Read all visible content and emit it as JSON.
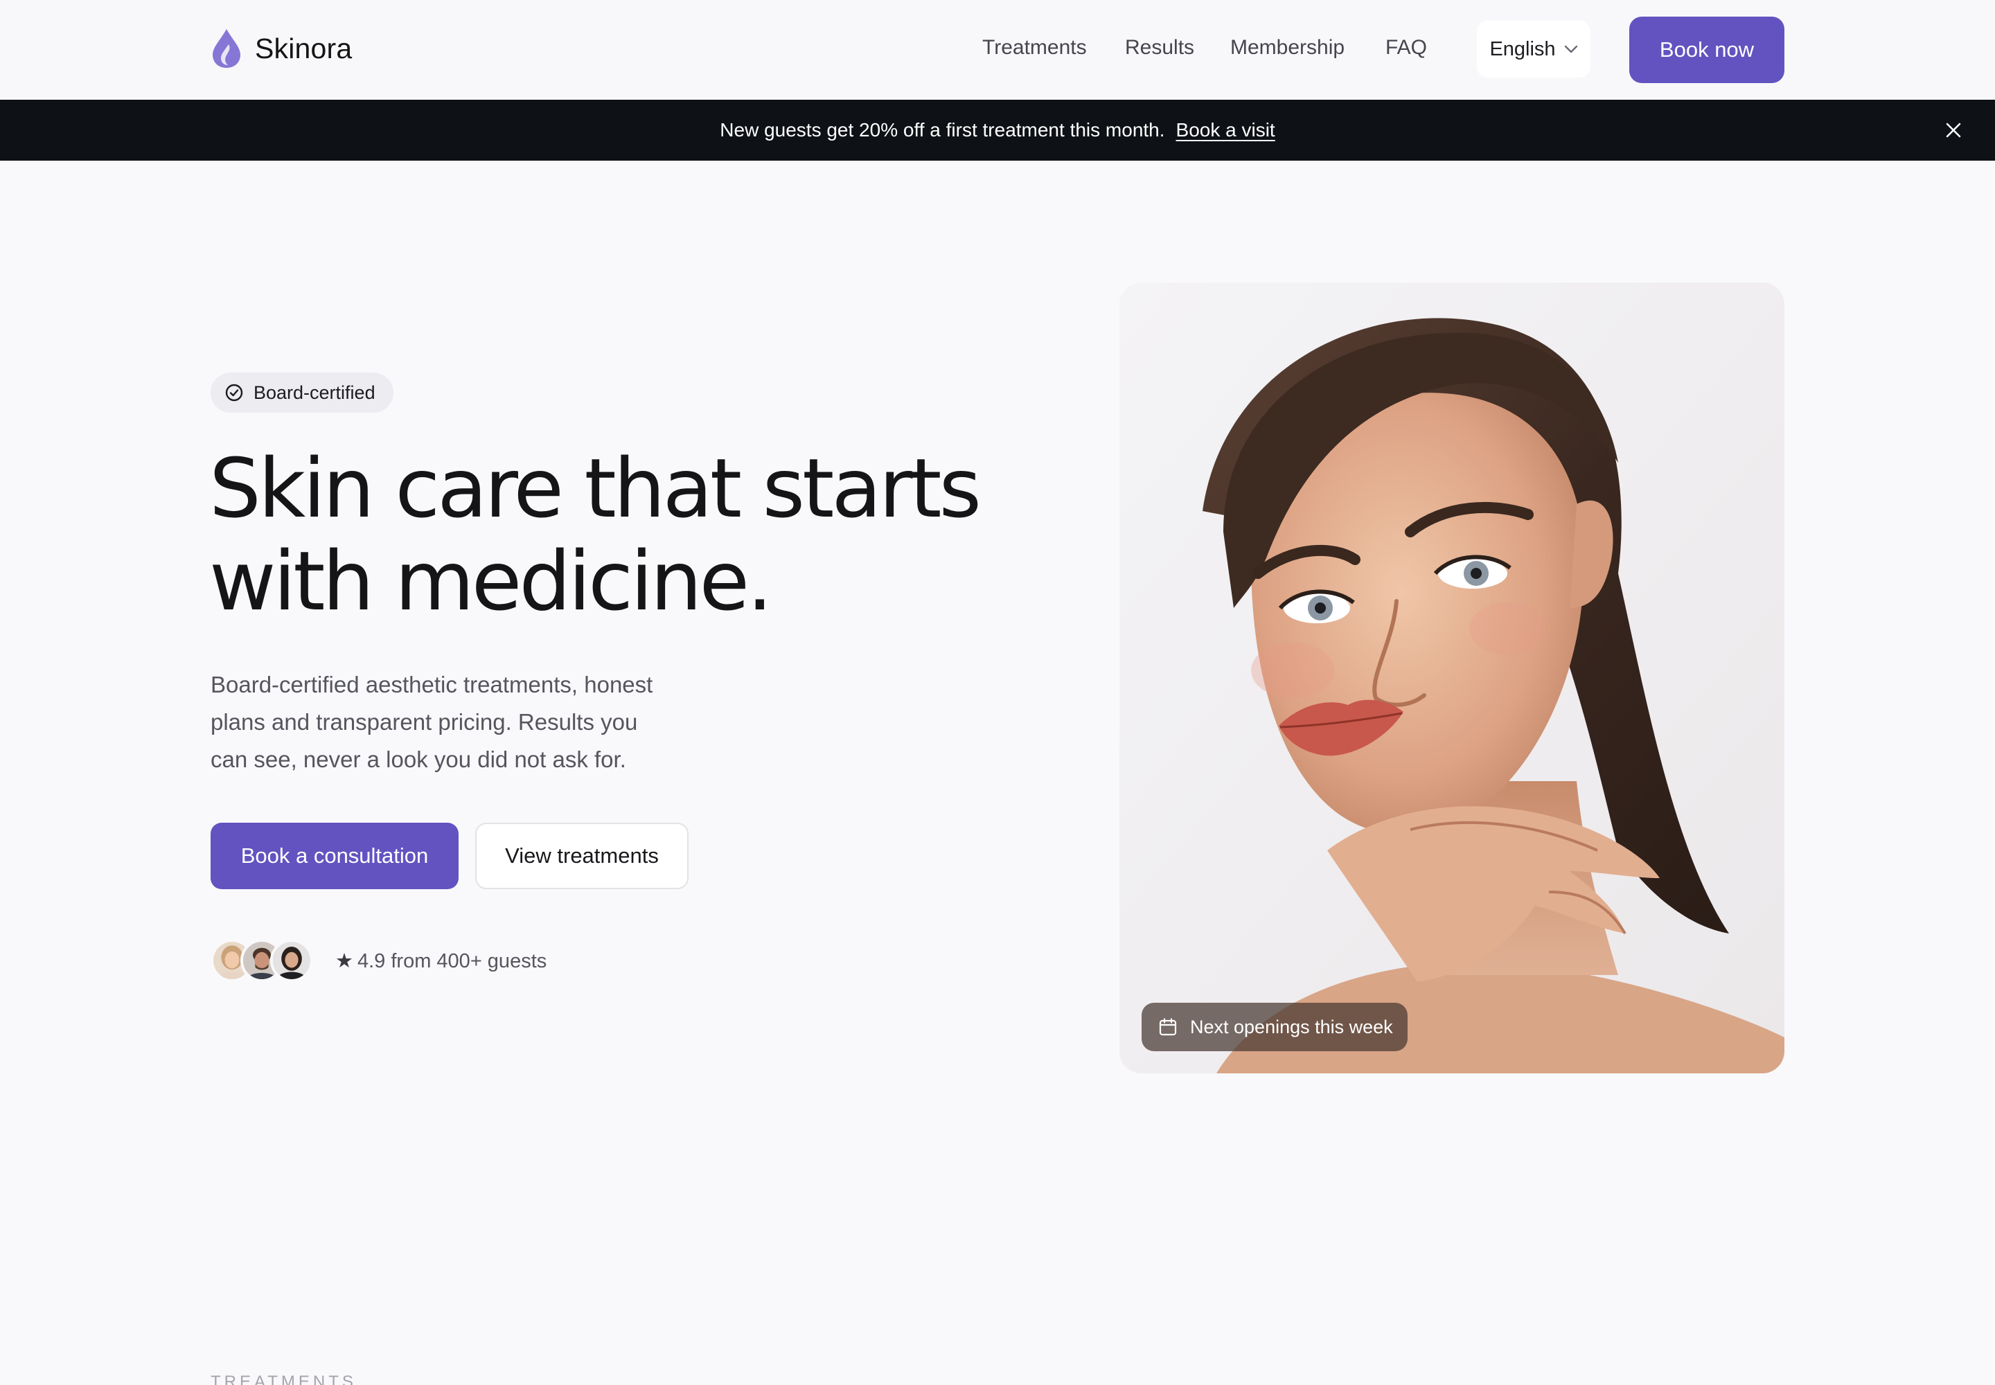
{
  "brand": {
    "name": "Skinora",
    "accent": "#6253c0"
  },
  "nav": {
    "items": [
      {
        "label": "Treatments"
      },
      {
        "label": "Results"
      },
      {
        "label": "Membership"
      },
      {
        "label": "FAQ"
      }
    ],
    "language": "English",
    "book_now": "Book now"
  },
  "announcement": {
    "text": "New guests get 20% off a first treatment this month.",
    "link": "Book a visit"
  },
  "hero": {
    "badge": "Board-certified",
    "headline_line1": "Skin care that starts",
    "headline_line2": "with medicine.",
    "lede_line1": "Board-certified aesthetic treatments, honest",
    "lede_line2": "plans and transparent pricing. Results you",
    "lede_line3": "can see, never a look you did not ask for.",
    "primary_cta": "Book a consultation",
    "secondary_cta": "View treatments",
    "rating": "4.9 from 400+ guests",
    "rating_star": "★",
    "image_overlay": "Next openings this week"
  },
  "section": {
    "label": "TREATMENTS"
  },
  "colors": {
    "announcement_bg": "#0e1116",
    "page_bg": "#f9f9fb",
    "text": "#16161a"
  }
}
